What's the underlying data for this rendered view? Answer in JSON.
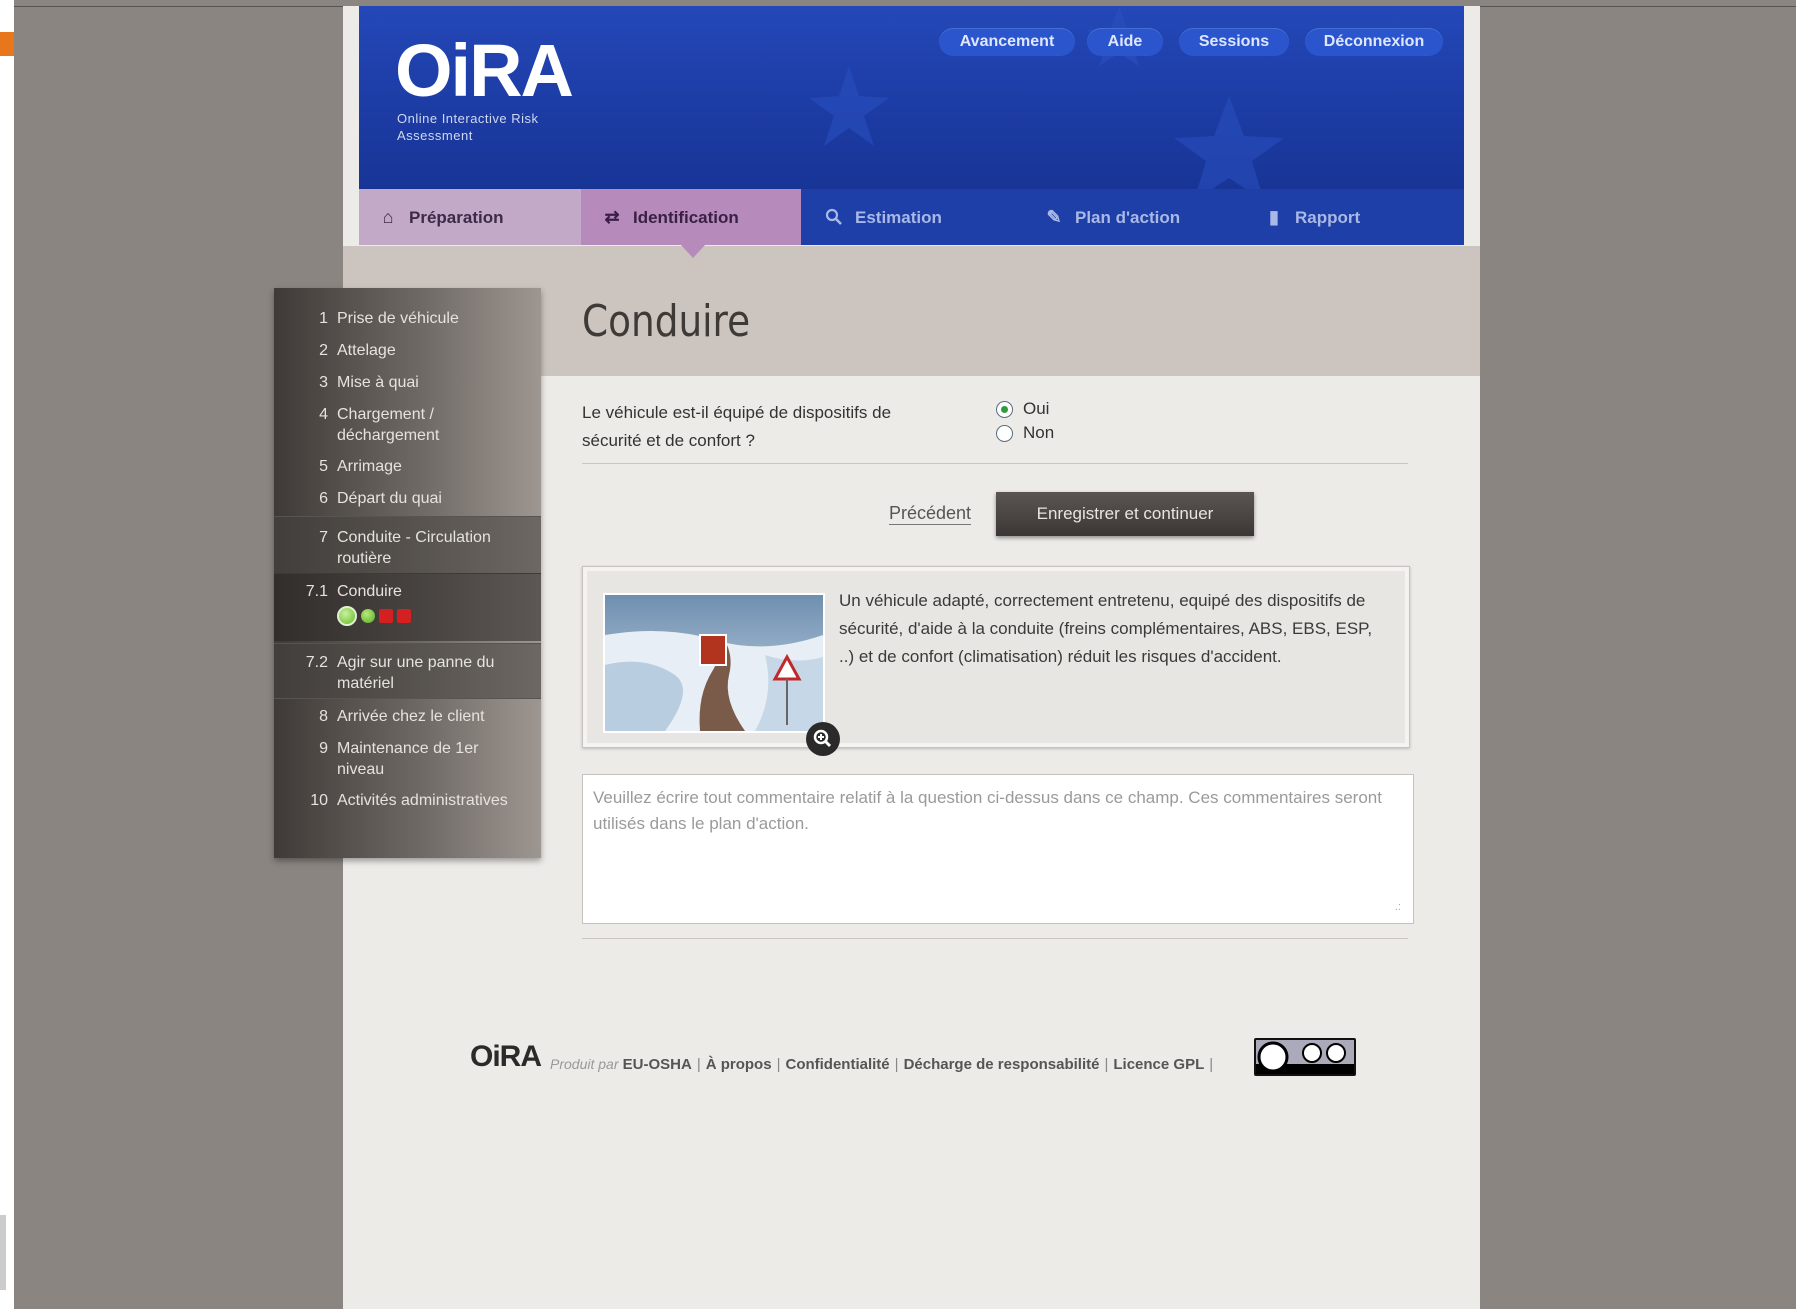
{
  "app": {
    "logo": "OiRA",
    "logo_sub": "Online Interactive Risk Assessment"
  },
  "top_buttons": [
    {
      "label": "Avancement"
    },
    {
      "label": "Aide"
    },
    {
      "label": "Sessions"
    },
    {
      "label": "Déconnexion"
    }
  ],
  "nav_tabs": [
    {
      "label": "Préparation",
      "icon": "house-icon"
    },
    {
      "label": "Identification",
      "icon": "arrows-icon",
      "active": true
    },
    {
      "label": "Estimation",
      "icon": "magnifier-icon"
    },
    {
      "label": "Plan d'action",
      "icon": "pencil-icon"
    },
    {
      "label": "Rapport",
      "icon": "document-icon"
    }
  ],
  "sidebar": {
    "items": [
      {
        "num": "1",
        "label": "Prise de véhicule"
      },
      {
        "num": "2",
        "label": "Attelage"
      },
      {
        "num": "3",
        "label": "Mise à quai"
      },
      {
        "num": "4",
        "label": "Chargement / déchargement"
      },
      {
        "num": "5",
        "label": "Arrimage"
      },
      {
        "num": "6",
        "label": "Départ du quai"
      },
      {
        "num": "7",
        "label": "Conduite - Circulation routière"
      },
      {
        "num": "7.1",
        "label": "Conduire"
      },
      {
        "num": "7.2",
        "label": "Agir sur une panne du matériel"
      },
      {
        "num": "8",
        "label": "Arrivée chez le client"
      },
      {
        "num": "9",
        "label": "Maintenance de 1er niveau"
      },
      {
        "num": "10",
        "label": "Activités administratives"
      }
    ]
  },
  "main": {
    "title": "Conduire",
    "question": "Le véhicule est-il équipé de dispositifs de sécurité et de confort ?",
    "options": [
      {
        "label": "Oui",
        "selected": true
      },
      {
        "label": "Non",
        "selected": false
      }
    ],
    "prev_label": "Précédent",
    "save_label": "Enregistrer et continuer",
    "info_text": "Un véhicule adapté, correctement entretenu, equipé des dispositifs de sécurité, d'aide à la conduite (freins complémentaires, ABS, EBS, ESP, ..) et de confort (climatisation) réduit les risques d'accident.",
    "comment_placeholder": "Veuillez écrire tout commentaire relatif à la question ci-dessus dans ce champ. Ces commentaires seront utilisés dans le plan d'action."
  },
  "footer": {
    "logo": "OiRA",
    "made_by": "Produit par",
    "links": [
      "EU-OSHA",
      "À propos",
      "Confidentialité",
      "Décharge de responsabilité",
      "Licence GPL"
    ],
    "separator": "|"
  },
  "colors": {
    "header_blue": "#1c3ba3",
    "tab_active": "#b68bbb",
    "tab_prep": "#c3a9c8",
    "radio_selected": "#2f9c3a"
  }
}
